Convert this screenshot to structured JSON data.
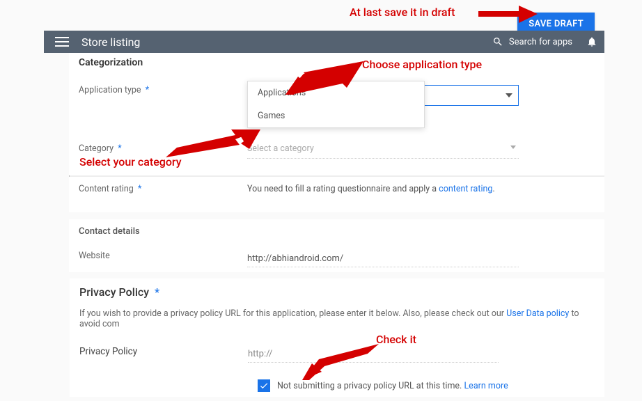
{
  "buttons": {
    "save_draft": "SAVE DRAFT"
  },
  "header": {
    "title": "Store listing",
    "search_placeholder": "Search for apps"
  },
  "annotations": {
    "save": "At last save it in draft",
    "apptype": "Choose application type",
    "category": "Select your category",
    "check": "Check it"
  },
  "categorization": {
    "title": "Categorization",
    "app_type_label": "Application type",
    "dropdown": [
      "Applications",
      "Games"
    ],
    "category_label": "Category",
    "category_placeholder": "Select a category",
    "rating_label": "Content rating",
    "rating_text_before": "You need to fill a rating questionnaire and apply a ",
    "rating_link": "content rating",
    "rating_text_after": "."
  },
  "contact": {
    "title": "Contact details",
    "website_label": "Website",
    "website_value": "http://abhiandroid.com/"
  },
  "privacy": {
    "title": "Privacy Policy",
    "desc_before": "If you wish to provide a privacy policy URL for this application, please enter it below. Also, please check out our ",
    "desc_link": "User Data policy",
    "desc_after": " to avoid com",
    "field_label": "Privacy Policy",
    "field_value": "http://",
    "checkbox_label": "Not submitting a privacy policy URL at this time. ",
    "checkbox_link": "Learn more"
  }
}
